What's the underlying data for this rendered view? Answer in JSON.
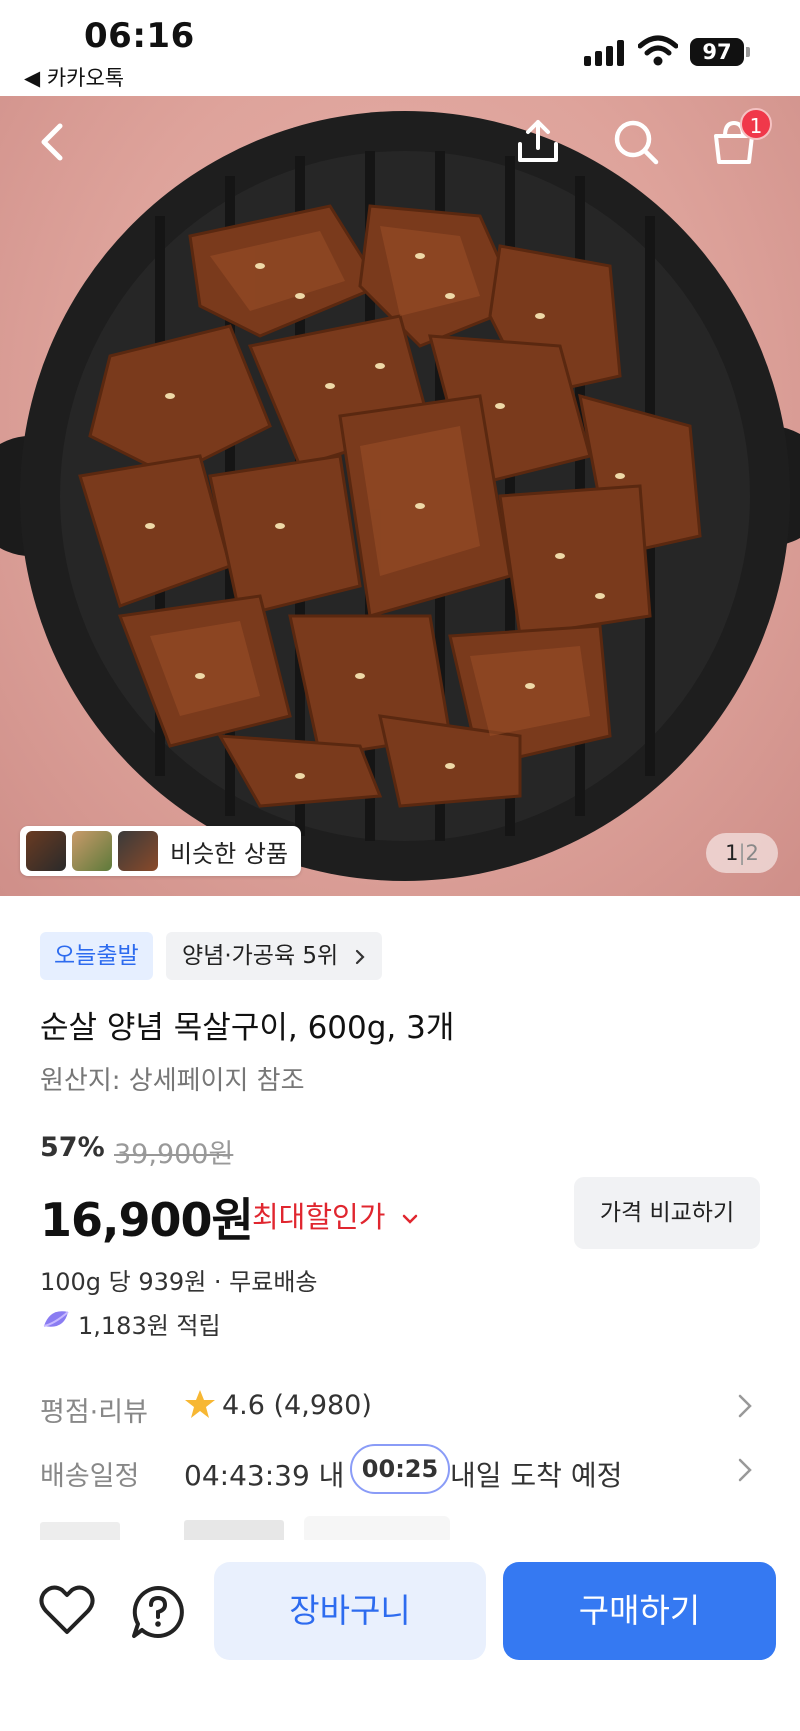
{
  "status_bar": {
    "time": "06:16",
    "back_app": "◀ 카카오톡",
    "battery": "97"
  },
  "header": {
    "cart_count": "1"
  },
  "gallery": {
    "similar_label": "비슷한 상품",
    "current_page": "1",
    "separator": "|",
    "total_pages": "2"
  },
  "product": {
    "badge_today": "오늘출발",
    "badge_rank": "양념·가공육 5위",
    "title": "순살 양념 목살구이, 600g, 3개",
    "origin": "원산지: 상세페이지 참조",
    "discount_rate": "57%",
    "original_price": "39,900원",
    "price": "16,900원",
    "max_discount_label": "최대할인가",
    "compare_label": "가격 비교하기",
    "unit_price": "100g 당 939원 · 무료배송",
    "points": "1,183원 적립"
  },
  "rows": {
    "rating_label": "평점·리뷰",
    "rating_value": "4.6 (4,980)",
    "delivery_label": "배송일정",
    "delivery_countdown": "04:43:39 내",
    "delivery_timer": "00:25",
    "delivery_eta": "내일 도착 예정"
  },
  "bottom_bar": {
    "cart_button": "장바구니",
    "buy_button": "구매하기"
  },
  "colors": {
    "primary": "#3579f2",
    "discount_red": "#e0262f",
    "badge_blue_bg": "#e6efff"
  }
}
